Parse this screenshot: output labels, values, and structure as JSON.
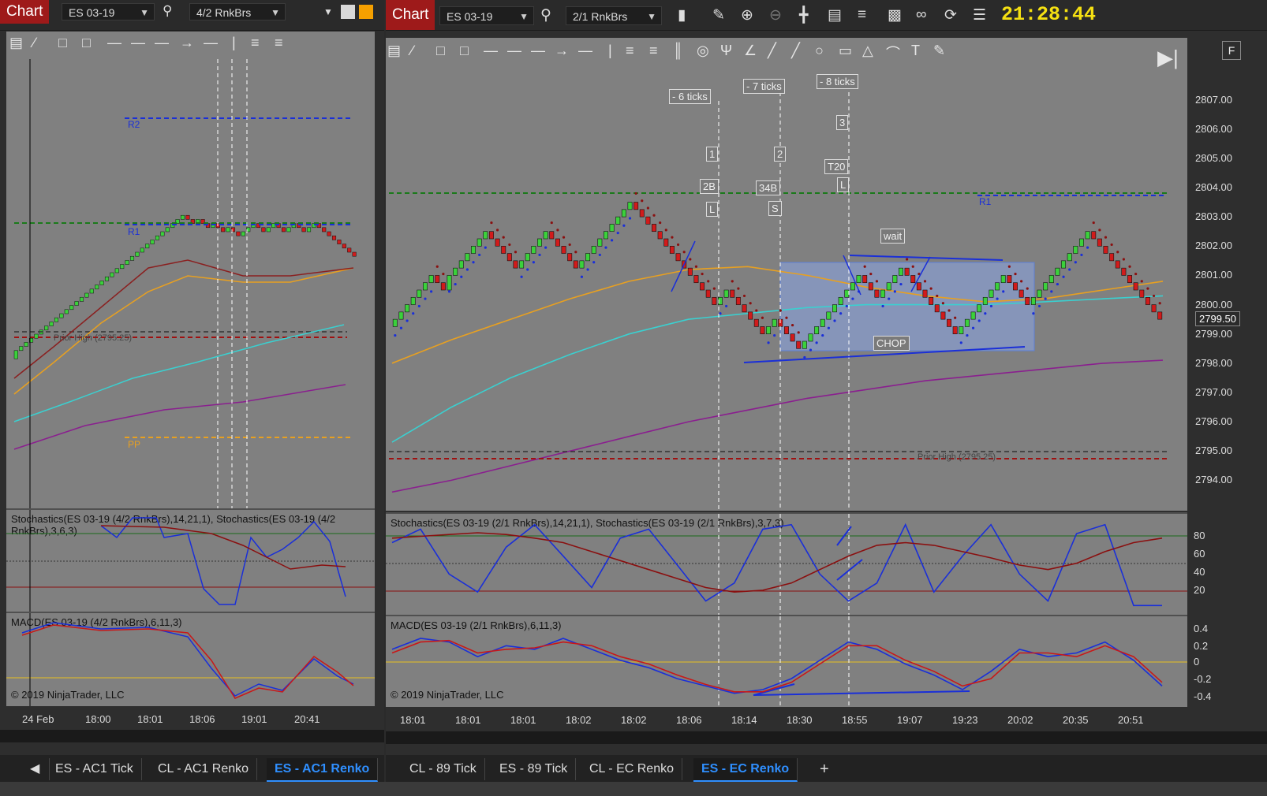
{
  "left": {
    "chart_tab": "Chart",
    "instrument": "ES 03-19",
    "bar_type": "4/2 RnkBrs",
    "level_labels": {
      "r2": "R2",
      "r1": "R1",
      "pp": "PP",
      "prior_high": "Prior High (2795.25)"
    },
    "stoch_label": "Stochastics(ES 03-19 (4/2 RnkBrs),14,21,1), Stochastics(ES 03-19 (4/2 RnkBrs),3,6,3)",
    "macd_label": "MACD(ES 03-19 (4/2 RnkBrs),6,11,3)",
    "copyright": "© 2019 NinjaTrader, LLC",
    "x_ticks": [
      "24 Feb",
      "18:00",
      "18:01",
      "18:06",
      "19:01",
      "20:41"
    ],
    "tabs": [
      "ES - AC1 Tick",
      "CL - AC1 Renko",
      "ES - AC1 Renko"
    ],
    "active_tab": "ES - AC1 Renko"
  },
  "right": {
    "chart_tab": "Chart",
    "instrument": "ES 03-19",
    "bar_type": "2/1 RnkBrs",
    "clock": "21:28:44",
    "f_button": "F",
    "stoch_label": "Stochastics(ES 03-19 (2/1 RnkBrs),14,21,1), Stochastics(ES 03-19 (2/1 RnkBrs),3,7,3)",
    "macd_label": "MACD(ES 03-19 (2/1 RnkBrs),6,11,3)",
    "copyright": "© 2019 NinjaTrader, LLC",
    "annotations": {
      "ticks6": "- 6 ticks",
      "ticks7": "- 7 ticks",
      "ticks8": "- 8 ticks",
      "n1": "1",
      "n2": "2",
      "n3": "3",
      "t20": "T20",
      "b2b": "2B",
      "b34b": "34B",
      "l1": "L",
      "l2": "L",
      "s1": "S",
      "wait": "wait",
      "chop": "CHOP"
    },
    "level_labels": {
      "r1": "R1",
      "prior_high": "Prior High (2795.25)"
    },
    "last_price": "2799.50",
    "price_ticks": [
      "2807.00",
      "2806.00",
      "2805.00",
      "2804.00",
      "2803.00",
      "2802.00",
      "2801.00",
      "2800.00",
      "2799.00",
      "2798.00",
      "2797.00",
      "2796.00",
      "2795.00",
      "2794.00"
    ],
    "stoch_ticks": [
      "80",
      "60",
      "40",
      "20"
    ],
    "macd_ticks": [
      "0.4",
      "0.2",
      "0",
      "-0.2",
      "-0.4"
    ],
    "x_ticks": [
      "18:01",
      "18:01",
      "18:01",
      "18:02",
      "18:02",
      "18:06",
      "18:14",
      "18:30",
      "18:55",
      "19:07",
      "19:23",
      "20:02",
      "20:35",
      "20:51"
    ],
    "tabs": [
      "CL - 89 Tick",
      "ES - 89 Tick",
      "CL - EC Renko",
      "ES - EC Renko"
    ],
    "active_tab": "ES - EC Renko",
    "plus": "+"
  },
  "colors": {
    "up_bar": "#3bd13b",
    "down_bar": "#d11b1b",
    "chart_tab": "#9e1a1a",
    "clock": "#f5e012",
    "active_tab": "#2f8fff"
  },
  "chart_data": [
    {
      "type": "candlestick",
      "title": "ES 03-19 (2/1 RnkBrs)",
      "ylim": [
        2793.5,
        2807.5
      ],
      "x_ticks": [
        "18:01",
        "18:01",
        "18:01",
        "18:02",
        "18:02",
        "18:06",
        "18:14",
        "18:30",
        "18:55",
        "19:07",
        "19:23",
        "20:02",
        "20:35",
        "20:51"
      ],
      "closes": [
        2799.5,
        2799.75,
        2800,
        2800.25,
        2800.5,
        2800.75,
        2801,
        2800.75,
        2800.5,
        2801,
        2801.25,
        2801.5,
        2801.75,
        2802,
        2802.25,
        2802.5,
        2802.25,
        2802,
        2801.75,
        2801.5,
        2801.25,
        2801.5,
        2801.75,
        2802,
        2802.25,
        2802.5,
        2802.25,
        2802,
        2801.75,
        2801.5,
        2801.25,
        2801.5,
        2801.75,
        2802,
        2802.25,
        2802.5,
        2802.75,
        2803,
        2803.25,
        2803.5,
        2803.25,
        2803,
        2802.75,
        2802.5,
        2802.25,
        2802,
        2801.75,
        2801.5,
        2801.25,
        2801,
        2800.75,
        2800.5,
        2800.25,
        2800,
        2800.25,
        2800.5,
        2800.25,
        2800,
        2799.75,
        2799.5,
        2799.25,
        2799,
        2799.25,
        2799.5,
        2799.25,
        2799,
        2798.75,
        2798.5,
        2798.75,
        2799,
        2799.25,
        2799.5,
        2799.75,
        2800,
        2800.25,
        2800.5,
        2800.75,
        2801,
        2800.75,
        2800.5,
        2800.25,
        2800.5,
        2800.75,
        2801,
        2801.25,
        2801,
        2800.75,
        2800.5,
        2800.25,
        2800,
        2799.75,
        2799.5,
        2799.25,
        2799,
        2799.25,
        2799.5,
        2799.75,
        2800,
        2800.25,
        2800.5,
        2800.75,
        2801,
        2800.75,
        2800.5,
        2800.25,
        2800,
        2800.25,
        2800.5,
        2800.75,
        2801,
        2801.25,
        2801.5,
        2801.75,
        2802,
        2802.25,
        2802.5,
        2802.25,
        2802,
        2801.75,
        2801.5,
        2801.25,
        2801,
        2800.75,
        2800.5,
        2800.25,
        2800,
        2799.75,
        2799.5
      ],
      "levels": {
        "R1": 2803.5,
        "Prior High": 2795.25
      },
      "moving_averages": [
        {
          "color": "#e8a020",
          "values": [
            2798,
            2798.8,
            2799.5,
            2800.2,
            2800.8,
            2801.2,
            2801.3,
            2801,
            2800.6,
            2800.3,
            2800.1,
            2800.2,
            2800.5,
            2800.8
          ]
        },
        {
          "color": "#3ad0d0",
          "values": [
            2795.3,
            2796.5,
            2797.5,
            2798.3,
            2799,
            2799.5,
            2799.7,
            2799.9,
            2800,
            2800,
            2800,
            2800.1,
            2800.2,
            2800.3
          ]
        },
        {
          "color": "#8a1f8f",
          "values": [
            2793.6,
            2794,
            2794.5,
            2795,
            2795.5,
            2796,
            2796.4,
            2796.8,
            2797.1,
            2797.4,
            2797.6,
            2797.8,
            2798,
            2798.1
          ]
        }
      ]
    },
    {
      "type": "line",
      "title": "Stochastics(ES 03-19 (2/1 RnkBrs),14,21,1), Stochastics(ES 03-19 (2/1 RnkBrs),3,7,3)",
      "ylim": [
        0,
        100
      ],
      "series": [
        {
          "color": "#1a2fd8",
          "values": [
            75,
            90,
            40,
            20,
            70,
            95,
            60,
            25,
            80,
            90,
            50,
            10,
            30,
            90,
            95,
            40,
            10,
            30,
            95,
            20,
            60,
            95,
            40,
            10,
            85,
            95,
            5,
            5
          ]
        },
        {
          "color": "#8a1010",
          "values": [
            80,
            82,
            84,
            86,
            84,
            80,
            75,
            65,
            55,
            45,
            35,
            25,
            20,
            22,
            30,
            45,
            60,
            72,
            75,
            72,
            65,
            58,
            50,
            45,
            52,
            65,
            75,
            80
          ]
        }
      ]
    },
    {
      "type": "line",
      "title": "MACD(ES 03-19 (2/1 RnkBrs),6,11,3)",
      "ylim": [
        -0.5,
        0.5
      ],
      "series": [
        {
          "color": "#1a2fd8",
          "values": [
            0.2,
            0.35,
            0.3,
            0.1,
            0.25,
            0.2,
            0.35,
            0.2,
            0.05,
            -0.05,
            -0.2,
            -0.3,
            -0.4,
            -0.35,
            -0.2,
            0.05,
            0.3,
            0.2,
            0.0,
            -0.15,
            -0.35,
            -0.1,
            0.2,
            0.1,
            0.15,
            0.3,
            0.05,
            -0.3
          ]
        },
        {
          "color": "#c81818",
          "values": [
            0.15,
            0.3,
            0.32,
            0.15,
            0.2,
            0.22,
            0.3,
            0.25,
            0.1,
            0.0,
            -0.15,
            -0.28,
            -0.38,
            -0.38,
            -0.25,
            0.0,
            0.25,
            0.25,
            0.05,
            -0.1,
            -0.3,
            -0.2,
            0.15,
            0.15,
            0.1,
            0.25,
            0.1,
            -0.25
          ]
        }
      ]
    }
  ]
}
